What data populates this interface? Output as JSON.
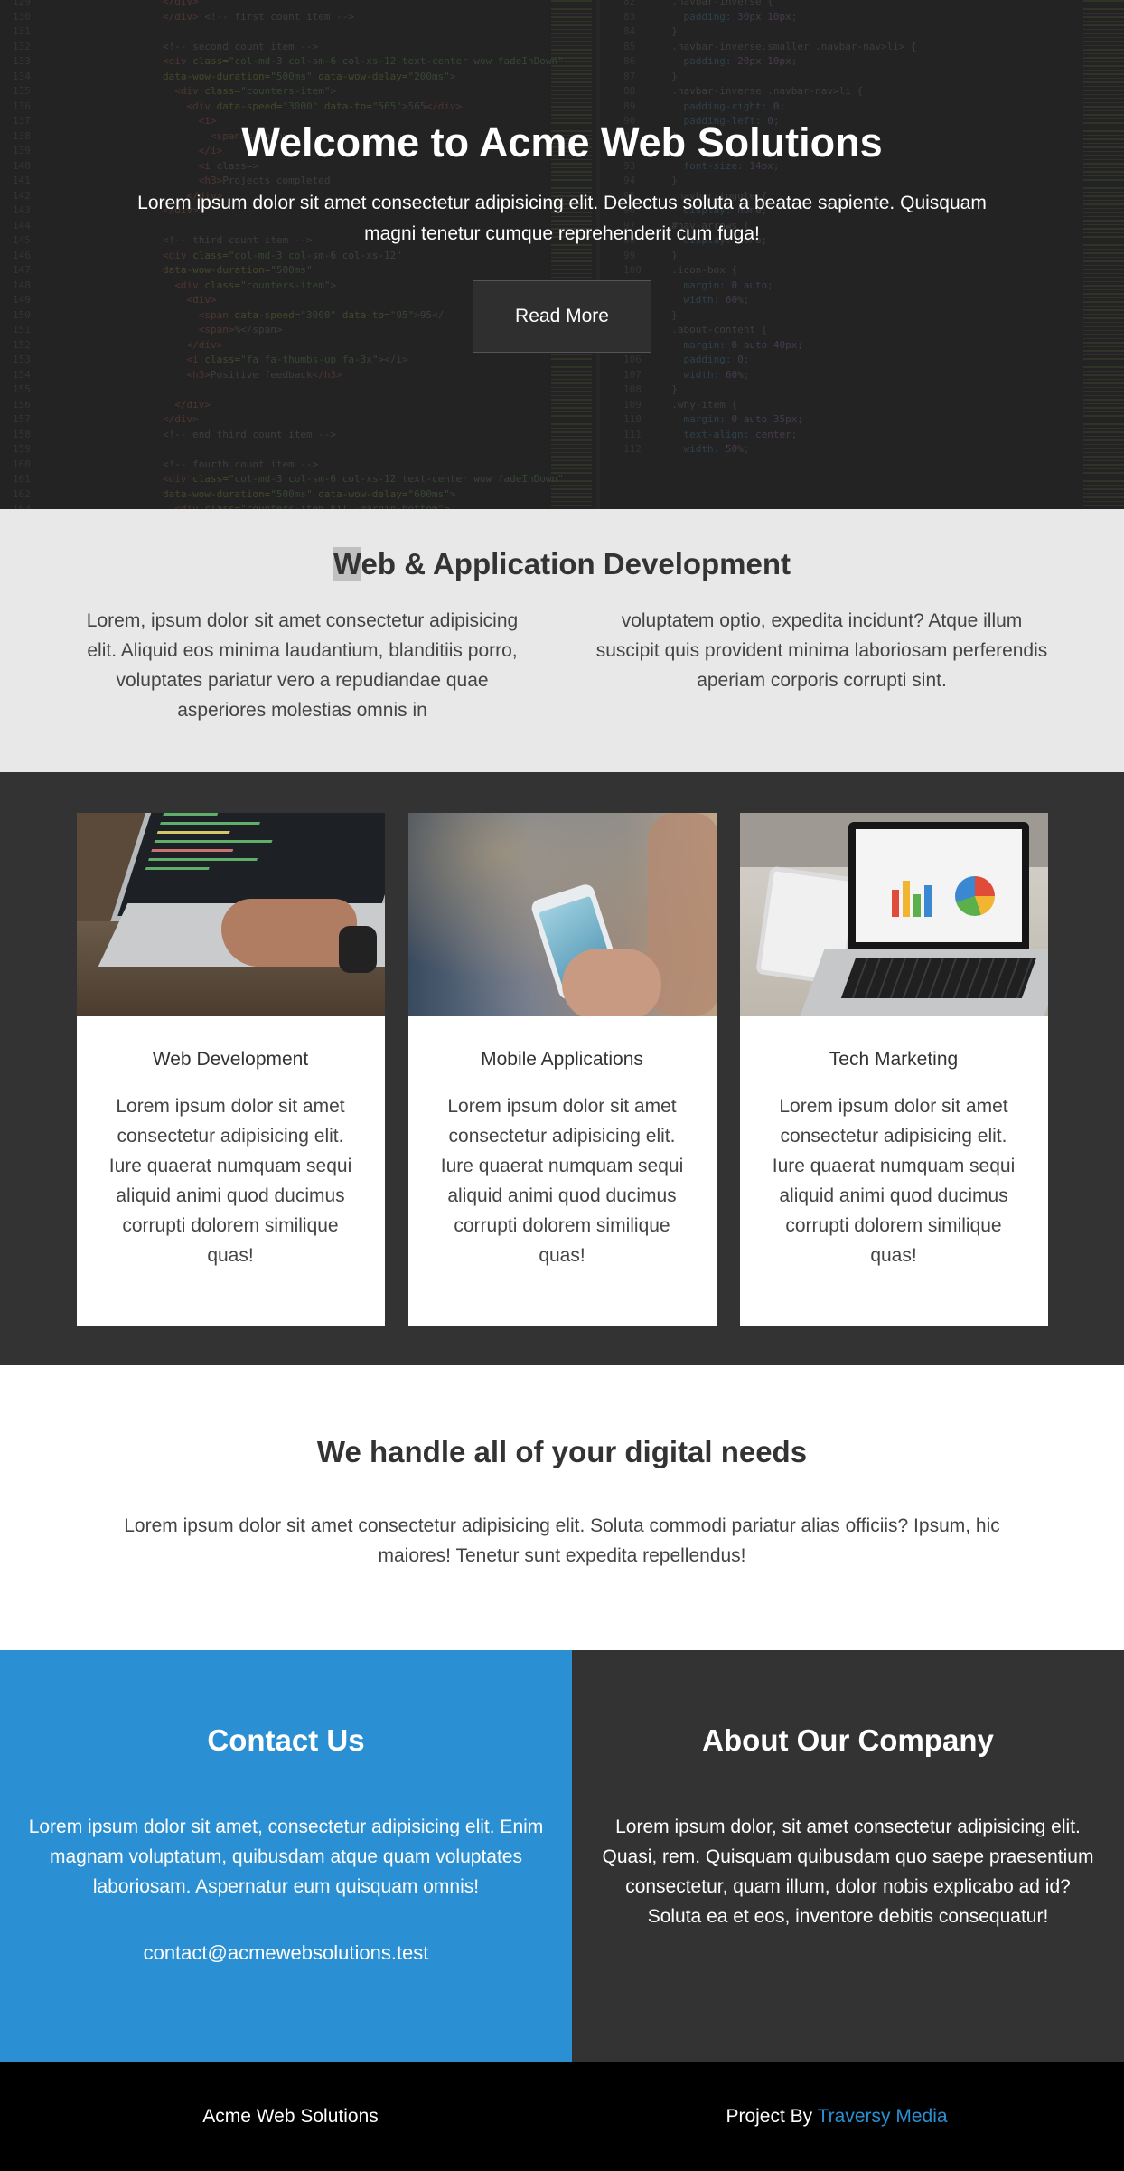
{
  "hero": {
    "title": "Welcome to Acme Web Solutions",
    "subtitle": "Lorem ipsum dolor sit amet consectetur adipisicing elit. Delectus soluta a beatae sapiente. Quisquam magni tenetur cumque reprehenderit cum fuga!",
    "button_label": "Read More"
  },
  "services_intro": {
    "heading_highlight": "W",
    "heading_rest": "eb & Application Development",
    "text_left": "Lorem, ipsum dolor sit amet consectetur adipisicing elit. Aliquid eos minima laudantium, blanditiis porro, voluptates pariatur vero a repudiandae quae asperiores molestias omnis in",
    "text_right": "voluptatem optio, expedita incidunt? Atque illum suscipit quis provident minima laboriosam perferendis aperiam corporis corrupti sint."
  },
  "cards": [
    {
      "title": "Web Development",
      "text": "Lorem ipsum dolor sit amet consectetur adipisicing elit. Iure quaerat numquam sequi aliquid animi quod ducimus corrupti dolorem similique quas!",
      "image": "laptop-coding-image"
    },
    {
      "title": "Mobile Applications",
      "text": "Lorem ipsum dolor sit amet consectetur adipisicing elit. Iure quaerat numquam sequi aliquid animi quod ducimus corrupti dolorem similique quas!",
      "image": "smartphone-in-hands-image"
    },
    {
      "title": "Tech Marketing",
      "text": "Lorem ipsum dolor sit amet consectetur adipisicing elit. Iure quaerat numquam sequi aliquid animi quod ducimus corrupti dolorem similique quas!",
      "image": "laptop-charts-image"
    }
  ],
  "digital_needs": {
    "heading": "We handle all of your digital needs",
    "text": "Lorem ipsum dolor sit amet consectetur adipisicing elit. Soluta commodi pariatur alias officiis? Ipsum, hic maiores! Tenetur sunt expedita repellendus!"
  },
  "contact": {
    "heading": "Contact Us",
    "text": "Lorem ipsum dolor sit amet, consectetur adipisicing elit. Enim magnam voluptatum, quibusdam atque quam voluptates laboriosam. Aspernatur eum quisquam omnis!",
    "email": "contact@acmewebsolutions.test"
  },
  "about": {
    "heading": "About Our Company",
    "text": "Lorem ipsum dolor, sit amet consectetur adipisicing elit. Quasi, rem. Quisquam quibusdam quo saepe praesentium consectetur, quam illum, dolor nobis explicabo ad id? Soluta ea et eos, inventore debitis consequatur!"
  },
  "footer": {
    "company": "Acme Web Solutions",
    "project_by": "Project By",
    "author_link": "Traversy Media"
  },
  "colors": {
    "accent_blue": "#2b8fd3",
    "dark": "#333333",
    "light_gray": "#e8e8e8"
  }
}
